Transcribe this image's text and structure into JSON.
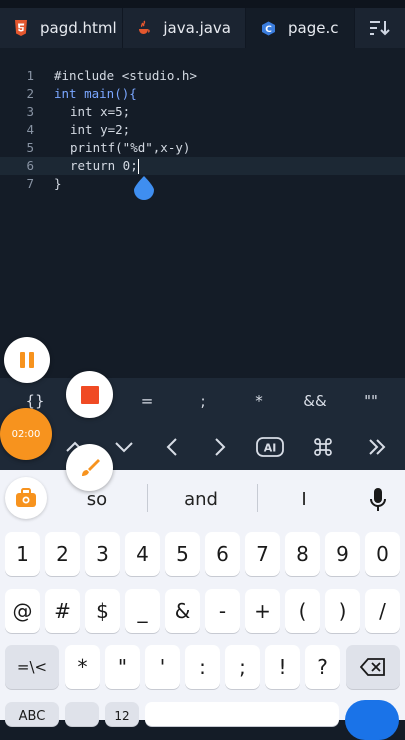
{
  "tabs": [
    {
      "label": "pagd.html",
      "icon": "html5-icon",
      "color": "#e4572e"
    },
    {
      "label": "java.java",
      "icon": "java-icon",
      "color": "#e4572e"
    },
    {
      "label": "page.c",
      "icon": "c-language-icon",
      "color": "#3b7ddd"
    }
  ],
  "active_tab": 2,
  "editor": {
    "line_numbers": [
      "1",
      "2",
      "3",
      "4",
      "5",
      "6",
      "7"
    ],
    "lines": [
      "#include <studio.h>",
      "int main(){",
      "int x=5;",
      "int y=2;",
      "printf(\"%d\",x-y)",
      "return 0;",
      "}"
    ],
    "current_line": 6
  },
  "symbols": [
    "{}",
    "=",
    ";",
    "*",
    "&&",
    "\"\""
  ],
  "recorder": {
    "timer": "02:00",
    "accent": "#f7931e",
    "stop_color": "#f04a23"
  },
  "keyboard": {
    "suggestions": [
      "so",
      "and",
      "I"
    ],
    "row1": [
      "1",
      "2",
      "3",
      "4",
      "5",
      "6",
      "7",
      "8",
      "9",
      "0"
    ],
    "row2": [
      "@",
      "#",
      "$",
      "_",
      "&",
      "-",
      "+",
      "(",
      ")",
      "/"
    ],
    "row3": [
      "=\\<",
      "*",
      "\"",
      "'",
      ":",
      ";",
      "!",
      "?"
    ],
    "row4_left": "ABC",
    "row4_num": "12"
  },
  "colors": {
    "accent_blue": "#1a73e8"
  }
}
